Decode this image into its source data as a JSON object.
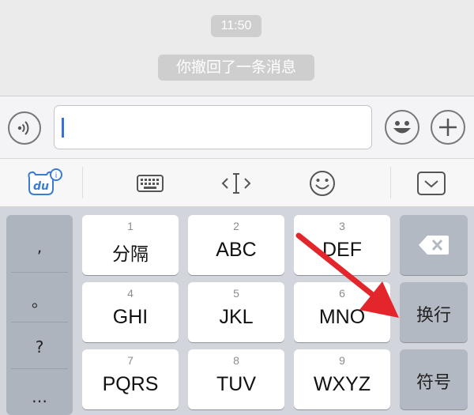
{
  "chat": {
    "time": "11:50",
    "recall_notice": "你撤回了一条消息"
  },
  "input_bar": {
    "voice_icon": "voice-icon",
    "text_value": "",
    "emoji_icon": "smiley-face-icon",
    "plus_icon": "plus-icon"
  },
  "toolbar": {
    "items": [
      "du-logo-icon",
      "keyboard-icon",
      "cursor-move-icon",
      "emoji-icon",
      "collapse-keyboard-icon"
    ],
    "logo_text": "du",
    "badge": "i"
  },
  "keyboard": {
    "punctuation": [
      ",",
      "。",
      "?",
      "…"
    ],
    "keys": [
      {
        "num": "1",
        "label": "分隔"
      },
      {
        "num": "2",
        "label": "ABC"
      },
      {
        "num": "3",
        "label": "DEF"
      },
      {
        "num": "4",
        "label": "GHI"
      },
      {
        "num": "5",
        "label": "JKL"
      },
      {
        "num": "6",
        "label": "MNO"
      },
      {
        "num": "7",
        "label": "PQRS"
      },
      {
        "num": "8",
        "label": "TUV"
      },
      {
        "num": "9",
        "label": "WXYZ"
      }
    ],
    "delete_icon": "backspace-icon",
    "newline_label": "换行",
    "symbols_label": "符号"
  },
  "colors": {
    "arrow": "#e3262b",
    "cursor": "#3a6fd8",
    "function_key": "#b3b9c3"
  }
}
